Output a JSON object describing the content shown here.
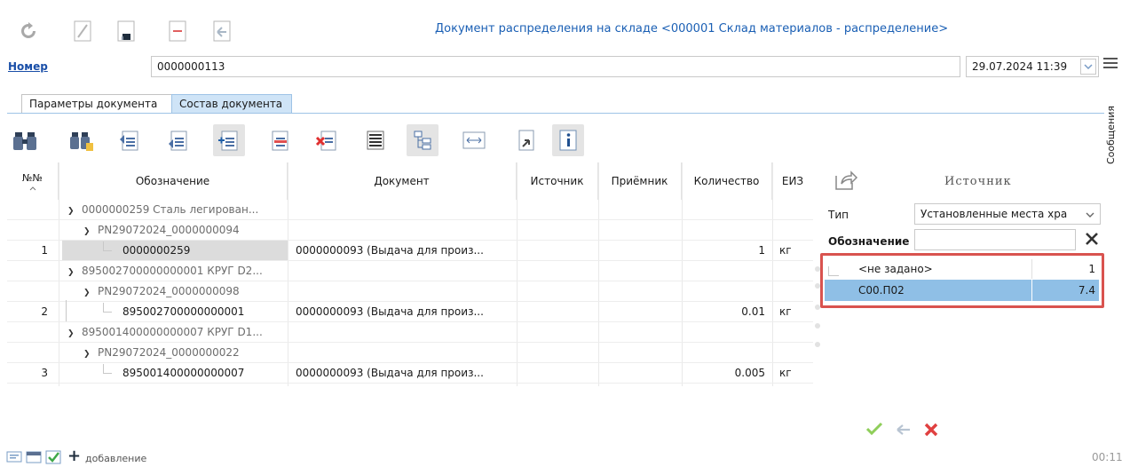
{
  "window": {
    "title": "Документ распределения на складе <000001 Склад материалов - распределение>"
  },
  "toolbar": {
    "icons": [
      "refresh-icon",
      "edit-icon",
      "save-icon",
      "delete-icon",
      "undo-icon"
    ]
  },
  "header": {
    "number_label": "Номер",
    "number_value": "0000000113",
    "datetime_value": "29.07.2024 11:39",
    "messages_label": "Сообщения"
  },
  "tabs": [
    {
      "label": "Параметры документа",
      "active": false
    },
    {
      "label": "Состав документа",
      "active": true
    }
  ],
  "grid": {
    "columns": [
      "№№",
      "Обозначение",
      "Документ",
      "Источник",
      "Приёмник",
      "Количество",
      "ЕИЗ"
    ],
    "rows": [
      {
        "num": "",
        "designation": "0000000259 Сталь легирован...",
        "level": 0,
        "document": "",
        "source": "",
        "receiver": "",
        "qty": "",
        "unit": ""
      },
      {
        "num": "",
        "designation": "PN29072024_0000000094",
        "level": 1,
        "document": "",
        "source": "",
        "receiver": "",
        "qty": "",
        "unit": ""
      },
      {
        "num": "1",
        "designation": "0000000259",
        "level": 2,
        "document": "0000000093 (Выдача для произ...",
        "source": "",
        "receiver": "",
        "qty": "1",
        "unit": "кг"
      },
      {
        "num": "",
        "designation": "895002700000000001 КРУГ D2...",
        "level": 0,
        "document": "",
        "source": "",
        "receiver": "",
        "qty": "",
        "unit": ""
      },
      {
        "num": "",
        "designation": "PN29072024_0000000098",
        "level": 1,
        "document": "",
        "source": "",
        "receiver": "",
        "qty": "",
        "unit": ""
      },
      {
        "num": "2",
        "designation": "895002700000000001",
        "level": 2,
        "document": "0000000093 (Выдача для произ...",
        "source": "",
        "receiver": "",
        "qty": "0.01",
        "unit": "кг"
      },
      {
        "num": "",
        "designation": "895001400000000007 КРУГ D1...",
        "level": 0,
        "document": "",
        "source": "",
        "receiver": "",
        "qty": "",
        "unit": ""
      },
      {
        "num": "",
        "designation": "PN29072024_0000000022",
        "level": 1,
        "document": "",
        "source": "",
        "receiver": "",
        "qty": "",
        "unit": ""
      },
      {
        "num": "3",
        "designation": "895001400000000007",
        "level": 2,
        "document": "0000000093 (Выдача для произ...",
        "source": "",
        "receiver": "",
        "qty": "0.005",
        "unit": "кг"
      }
    ]
  },
  "source_panel": {
    "title": "Источник",
    "type_label": "Тип",
    "type_value": "Установленные места хра",
    "designation_label": "Обозначение",
    "designation_value": "",
    "list": [
      {
        "label": "<не задано>",
        "value": "1",
        "selected": false
      },
      {
        "label": "С00.П02",
        "value": "7.4",
        "selected": true
      }
    ],
    "highlight_color": "#d9534f"
  },
  "statusbar": {
    "add_label": "добавление",
    "time": "00:11"
  },
  "colors": {
    "accent": "#1a5fb4",
    "selection": "#cfe4f7",
    "ok": "#4caf50",
    "cancel": "#d93025"
  }
}
